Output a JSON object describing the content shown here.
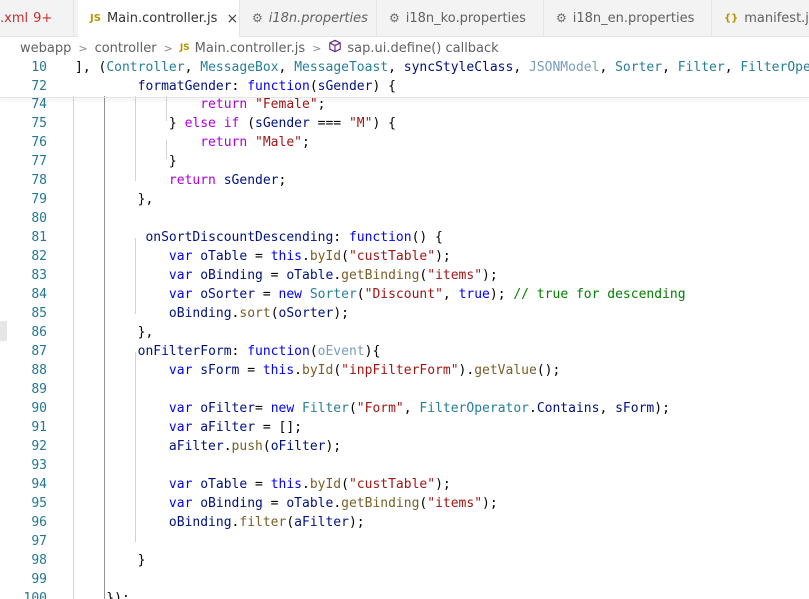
{
  "tabs": [
    {
      "label": ".xml",
      "badge": "9+",
      "icon": "",
      "state": "error"
    },
    {
      "label": "Main.controller.js",
      "icon": "js-file-icon",
      "icon_text": "JS",
      "state": "active",
      "close": "×"
    },
    {
      "label": "i18n.properties",
      "icon": "gear-icon",
      "icon_text": "⚙",
      "state": "preview"
    },
    {
      "label": "i18n_ko.properties",
      "icon": "gear-icon",
      "icon_text": "⚙",
      "state": "normal"
    },
    {
      "label": "i18n_en.properties",
      "icon": "gear-icon",
      "icon_text": "⚙",
      "state": "normal"
    },
    {
      "label": "manifest.json",
      "icon": "json-braces-icon",
      "icon_text": "{}",
      "state": "normal"
    }
  ],
  "breadcrumb": {
    "items": [
      "webapp",
      "controller",
      "Main.controller.js",
      "sap.ui.define() callback"
    ],
    "js_icon": "JS",
    "sep": ">"
  },
  "colors": {
    "keyword": "#0000ff",
    "control": "#af00db",
    "string": "#a31515",
    "function": "#795e26",
    "variable": "#001080",
    "class": "#267f99",
    "comment": "#008000",
    "line_number": "#237893"
  },
  "code": {
    "sticky": [
      {
        "num": "10",
        "text": "], (Controller, MessageBox, MessageToast, syncStyleClass, JSONModel, Sorter, Filter, FilterOpera"
      },
      {
        "num": "72",
        "text": "        formatGender: function(sGender) {"
      }
    ],
    "lines": [
      {
        "num": "74",
        "text": "                return \"Female\";"
      },
      {
        "num": "75",
        "text": "            } else if (sGender === \"M\") {"
      },
      {
        "num": "76",
        "text": "                return \"Male\";"
      },
      {
        "num": "77",
        "text": "            }"
      },
      {
        "num": "78",
        "text": "            return sGender;"
      },
      {
        "num": "79",
        "text": "        },"
      },
      {
        "num": "80",
        "text": ""
      },
      {
        "num": "81",
        "text": "         onSortDiscountDescending: function() {"
      },
      {
        "num": "82",
        "text": "            var oTable = this.byId(\"custTable\");"
      },
      {
        "num": "83",
        "text": "            var oBinding = oTable.getBinding(\"items\");"
      },
      {
        "num": "84",
        "text": "            var oSorter = new Sorter(\"Discount\", true); // true for descending"
      },
      {
        "num": "85",
        "text": "            oBinding.sort(oSorter);"
      },
      {
        "num": "86",
        "text": "        },"
      },
      {
        "num": "87",
        "text": "        onFilterForm: function(oEvent){"
      },
      {
        "num": "88",
        "text": "            var sForm = this.byId(\"inpFilterForm\").getValue();"
      },
      {
        "num": "89",
        "text": ""
      },
      {
        "num": "90",
        "text": "            var oFilter= new Filter(\"Form\", FilterOperator.Contains, sForm);"
      },
      {
        "num": "91",
        "text": "            var aFilter = [];"
      },
      {
        "num": "92",
        "text": "            aFilter.push(oFilter);"
      },
      {
        "num": "93",
        "text": ""
      },
      {
        "num": "94",
        "text": "            var oTable = this.byId(\"custTable\");"
      },
      {
        "num": "95",
        "text": "            var oBinding = oTable.getBinding(\"items\");"
      },
      {
        "num": "96",
        "text": "            oBinding.filter(aFilter);"
      },
      {
        "num": "97",
        "text": ""
      },
      {
        "num": "98",
        "text": "        }"
      },
      {
        "num": "99",
        "text": ""
      },
      {
        "num": "100",
        "text": "    });"
      }
    ]
  }
}
